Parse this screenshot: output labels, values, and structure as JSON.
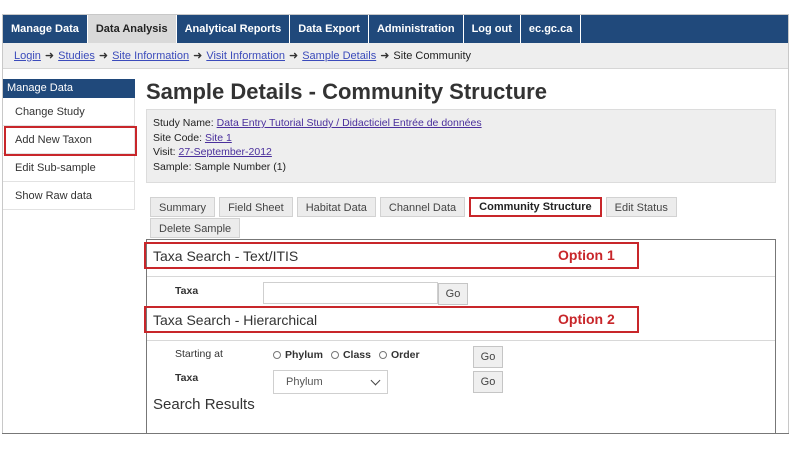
{
  "nav": {
    "tabs": [
      {
        "label": "Manage Data"
      },
      {
        "label": "Data Analysis"
      },
      {
        "label": "Analytical Reports"
      },
      {
        "label": "Data Export"
      },
      {
        "label": "Administration"
      },
      {
        "label": "Log out"
      },
      {
        "label": "ec.gc.ca"
      }
    ],
    "active_index": 1
  },
  "breadcrumb": {
    "items": [
      "Login",
      "Studies",
      "Site Information",
      "Visit Information",
      "Sample Details"
    ],
    "current": "Site Community"
  },
  "sidebar": {
    "heading": "Manage Data",
    "items": [
      {
        "label": "Change Study"
      },
      {
        "label": "Add New Taxon"
      },
      {
        "label": "Edit Sub-sample"
      },
      {
        "label": "Show Raw data"
      }
    ]
  },
  "page": {
    "title": "Sample Details - Community Structure"
  },
  "info": {
    "study_label": "Study Name: ",
    "study_value": "Data Entry Tutorial Study / Didacticiel Entrée de données",
    "site_label": "Site Code: ",
    "site_value": "Site 1",
    "visit_label": "Visit: ",
    "visit_value": "27-September-2012",
    "sample_text": "Sample: Sample Number (1)"
  },
  "subtabs": [
    {
      "label": "Summary"
    },
    {
      "label": "Field Sheet"
    },
    {
      "label": "Habitat Data"
    },
    {
      "label": "Channel Data"
    },
    {
      "label": "Community Structure"
    },
    {
      "label": "Edit Status"
    },
    {
      "label": "Delete Sample"
    }
  ],
  "search_text": {
    "title": "Taxa Search - Text/ITIS",
    "option_label": "Option 1",
    "taxa_label": "Taxa",
    "taxa_value": "",
    "go_label": "Go"
  },
  "search_hier": {
    "title": "Taxa Search - Hierarchical",
    "option_label": "Option 2",
    "starting_label": "Starting at",
    "radios": [
      "Phylum",
      "Class",
      "Order"
    ],
    "taxa_label": "Taxa",
    "select_value": "Phylum",
    "go_label_1": "Go",
    "go_label_2": "Go"
  },
  "results": {
    "title": "Search Results"
  },
  "colors": {
    "nav": "#20497b",
    "annotation_red": "#c8262a",
    "link": "#3b4bbb"
  }
}
